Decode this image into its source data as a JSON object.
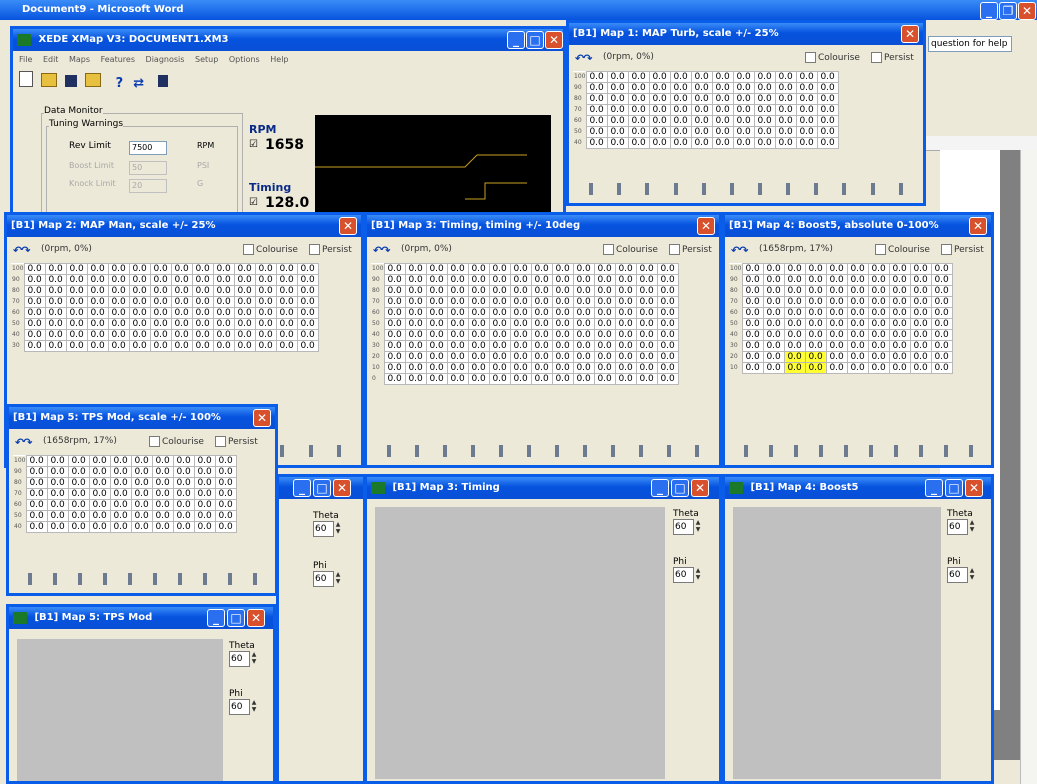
{
  "word": {
    "title": "Document9 - Microsoft Word",
    "help_text": "question for help"
  },
  "xede": {
    "title": "XEDE XMap V3: DOCUMENT1.XM3",
    "menu": [
      "File",
      "Edit",
      "Maps",
      "Features",
      "Diagnosis",
      "Setup",
      "Options",
      "Help"
    ],
    "data_monitor_label": "Data Monitor",
    "tuning_warnings_label": "Tuning Warnings",
    "rev_limit_label": "Rev Limit",
    "rev_limit_value": "7500",
    "rev_limit_unit": "RPM",
    "boost_limit_label": "Boost Limit",
    "boost_limit_value": "50",
    "boost_limit_unit": "PSI",
    "knock_limit_label": "Knock Limit",
    "knock_limit_value": "20",
    "knock_limit_unit": "G",
    "rpm_label": "RPM",
    "rpm_value": "1658",
    "timing_label": "Timing",
    "timing_value": "128.0"
  },
  "map1": {
    "title": "[B1] Map 1: MAP Turb, scale +/- 25%",
    "pos": "(0rpm, 0%)",
    "colourise": "Colourise",
    "persist": "Persist",
    "row_labels": [
      "100",
      "90",
      "80",
      "70",
      "60",
      "50",
      "40"
    ]
  },
  "map2": {
    "title": "[B1] Map 2: MAP Man, scale +/- 25%",
    "pos": "(0rpm, 0%)",
    "colourise": "Colourise",
    "persist": "Persist",
    "row_labels": [
      "100",
      "90",
      "80",
      "70",
      "60",
      "50",
      "40",
      "30"
    ]
  },
  "map3": {
    "title": "[B1] Map 3: Timing, timing +/- 10deg",
    "pos": "(0rpm, 0%)",
    "colourise": "Colourise",
    "persist": "Persist",
    "row_labels": [
      "100",
      "90",
      "80",
      "70",
      "60",
      "50",
      "40",
      "30",
      "20",
      "10",
      "0"
    ]
  },
  "map4": {
    "title": "[B1] Map 4: Boost5, absolute 0-100%",
    "pos": "(1658rpm, 17%)",
    "colourise": "Colourise",
    "persist": "Persist",
    "row_labels": [
      "100",
      "90",
      "80",
      "70",
      "60",
      "50",
      "40",
      "30",
      "20",
      "10"
    ]
  },
  "map5": {
    "title": "[B1] Map 5: TPS Mod, scale +/- 100%",
    "pos": "(1658rpm, 17%)",
    "colourise": "Colourise",
    "persist": "Persist",
    "row_labels": [
      "100",
      "90",
      "80",
      "70",
      "60",
      "50",
      "40"
    ]
  },
  "cell_value": "0.0",
  "view3": {
    "title": "[B1] Map 3: Timing",
    "theta_label": "Theta",
    "theta": "60",
    "phi_label": "Phi",
    "phi": "60"
  },
  "view4": {
    "title": "[B1] Map 4: Boost5",
    "theta_label": "Theta",
    "theta": "60",
    "phi_label": "Phi",
    "phi": "60"
  },
  "view5": {
    "title": "[B1] Map 5: TPS Mod",
    "theta_label": "Theta",
    "theta": "60",
    "phi_label": "Phi",
    "phi": "60"
  },
  "icons": {
    "close": "✕",
    "min": "_",
    "max": "□",
    "restore": "❐"
  },
  "colors": {
    "titlebar": "#0653de",
    "highlight": "#ffff33",
    "plot_bg": "#c0c0c0"
  }
}
